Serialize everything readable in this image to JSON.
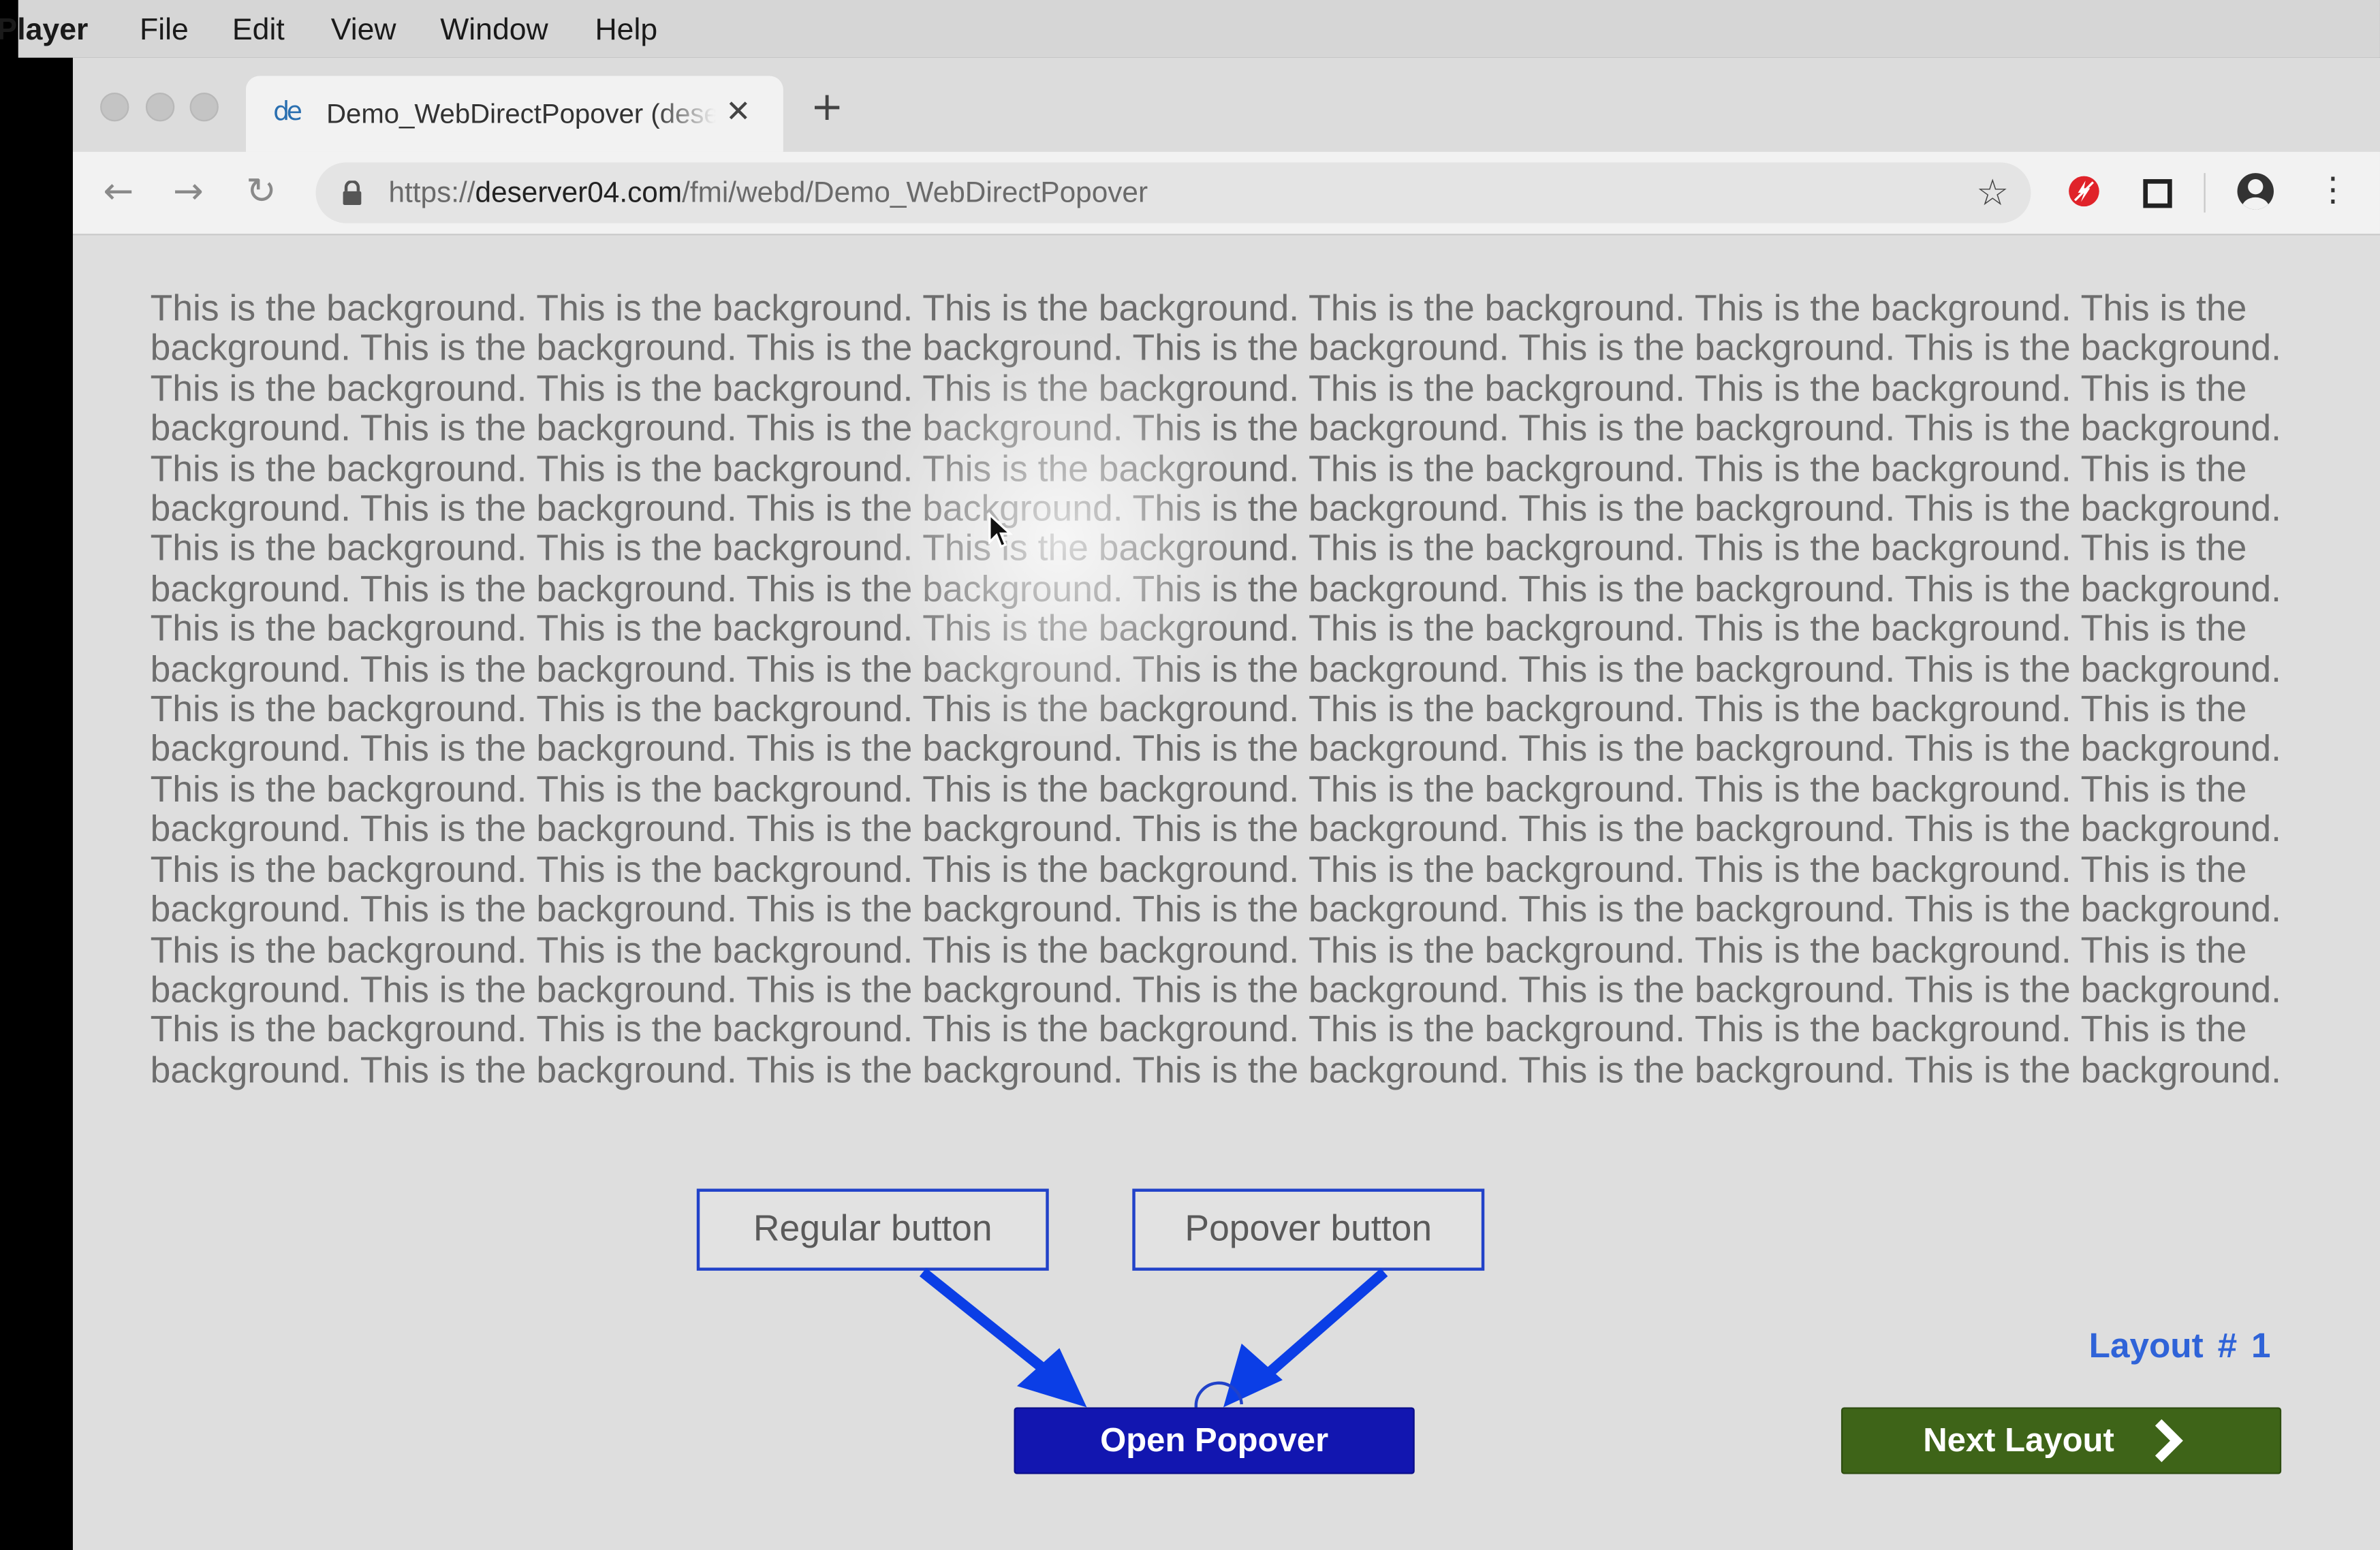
{
  "menubar": {
    "app_name": "Player",
    "items": [
      "File",
      "Edit",
      "View",
      "Window",
      "Help"
    ]
  },
  "browser": {
    "tab": {
      "favicon_text": "de",
      "title": "Demo_WebDirectPopover (deserver04)",
      "close_glyph": "✕"
    },
    "new_tab_glyph": "+",
    "nav": {
      "back_glyph": "←",
      "forward_glyph": "→",
      "reload_glyph": "↻"
    },
    "url": {
      "scheme": "https://",
      "host": "deserver04.com",
      "path": "/fmi/webd/Demo_WebDirectPopover"
    },
    "bookmark_glyph": "☆",
    "menu_glyph": "⋮",
    "icons": [
      "lock-icon",
      "star-icon",
      "flash-blocked-icon",
      "cast-icon",
      "profile-icon",
      "kebab-menu-icon"
    ]
  },
  "page": {
    "background_sentence": "This is the background.",
    "background_repeat_count": 110,
    "annotations": {
      "regular_button_label": "Regular button",
      "popover_button_label": "Popover button"
    },
    "open_popover_label": "Open Popover",
    "layout_label": "Layout  # 1",
    "next_layout_label": "Next Layout",
    "colors": {
      "open_popover_bg": "#1216b0",
      "next_layout_bg": "#3e6418",
      "annotation_blue": "#0b3ee6",
      "layout_label": "#2f63d8"
    }
  }
}
